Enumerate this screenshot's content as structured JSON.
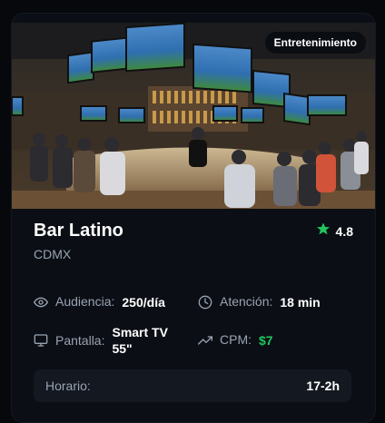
{
  "venue": {
    "category_badge": "Entretenimiento",
    "name": "Bar Latino",
    "location": "CDMX",
    "rating": "4.8",
    "image_icon": "sports-bar-photo",
    "star_icon": "star-icon"
  },
  "stats": {
    "audience": {
      "label": "Audiencia:",
      "value": "250/día",
      "icon": "eye-icon"
    },
    "attention": {
      "label": "Atención:",
      "value": "18 min",
      "icon": "clock-icon"
    },
    "screen": {
      "label": "Pantalla:",
      "value": "Smart TV 55\"",
      "icon": "monitor-icon"
    },
    "cpm": {
      "label": "CPM:",
      "value": "$7",
      "icon": "trending-up-icon"
    }
  },
  "hours": {
    "label": "Horario:",
    "value": "17-2h"
  },
  "colors": {
    "accent_green": "#22c55e",
    "background": "#06080c",
    "card": "#0b0f15",
    "muted_text": "#9aa3b2"
  }
}
